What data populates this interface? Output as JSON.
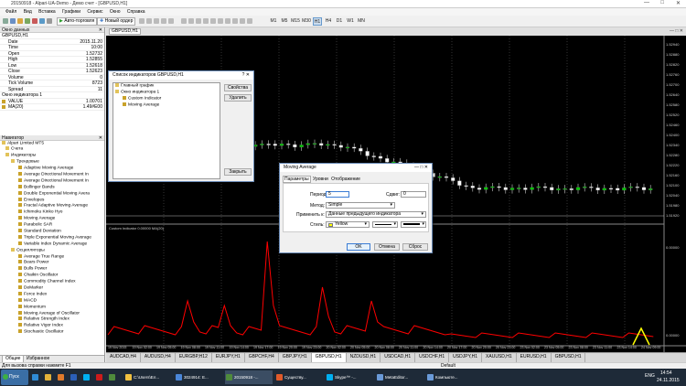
{
  "window": {
    "title": "20150918 - Alpari-UA-Demo - Демо счет - [GBPUSD,H1]"
  },
  "menu": [
    "Файл",
    "Вид",
    "Вставка",
    "Графики",
    "Сервис",
    "Окно",
    "Справка"
  ],
  "toolbar": {
    "autotrade_label": "Авто-торговля",
    "new_order_label": "Новый ордер",
    "timeframes": [
      "M1",
      "M5",
      "M15",
      "M30",
      "H1",
      "H4",
      "D1",
      "W1",
      "MN"
    ],
    "selected_timeframe": "H1"
  },
  "data_window": {
    "title": "Окно данных",
    "symbol": "GBPUSD,H1",
    "rows": [
      {
        "label": "Date",
        "value": "2015.11.20"
      },
      {
        "label": "Time",
        "value": "10:00"
      },
      {
        "label": "Open",
        "value": "1.52732"
      },
      {
        "label": "High",
        "value": "1.52855"
      },
      {
        "label": "Low",
        "value": "1.52618"
      },
      {
        "label": "Close",
        "value": "1.52623"
      },
      {
        "label": "Volume",
        "value": "0"
      },
      {
        "label": "Tick Volume",
        "value": "8723"
      },
      {
        "label": "Spread",
        "value": "11"
      }
    ],
    "indicator_window": "Окно индикатора 1",
    "ind_rows": [
      {
        "label": "VALUE",
        "value": "1.00701"
      },
      {
        "label": "MA(20)",
        "value": "1.49#E00"
      }
    ]
  },
  "navigator": {
    "title": "Навигатор",
    "broker": "Alpari Limited MT5",
    "accounts": "Счета",
    "indicators": "Индикаторы",
    "trend": "Трендовые",
    "trend_items": [
      "Adaptive Moving Average",
      "Average Directional Movement In",
      "Average Directional Movement In",
      "Bollinger Bands",
      "Double Exponential Moving Avera",
      "Envelopes",
      "Fractal Adaptive Moving Average",
      "Ichimoku Kinko Hyo",
      "Moving Average",
      "Parabolic SAR",
      "Standard Deviation",
      "Triple Exponential Moving Average",
      "Variable Index Dynamic Average"
    ],
    "osc": "Осцилляторы",
    "osc_items": [
      "Average True Range",
      "Bears Power",
      "Bulls Power",
      "Chaikin Oscillator",
      "Commodity Channel Index",
      "DeMarker",
      "Force Index",
      "MACD",
      "Momentum",
      "Moving Average of Oscillator",
      "Relative Strength Index",
      "Relative Vigor Index",
      "Stochastic Oscillator"
    ],
    "tabs": [
      "Общие",
      "Избранное"
    ]
  },
  "chart": {
    "tab_label": "GBPUSD,H1",
    "sub_label": "Custom Indicator 0.00000 MA(20)",
    "price_labels": [
      "1.52940",
      "1.52880",
      "1.52820",
      "1.52760",
      "1.52700",
      "1.52640",
      "1.52580",
      "1.52520",
      "1.52460",
      "1.52400",
      "1.52340",
      "1.52280",
      "1.52220",
      "1.52160",
      "1.52100",
      "1.52040",
      "1.51980",
      "1.51920"
    ],
    "sub_price_labels": [
      "0.00000",
      "0.00000"
    ],
    "time_labels": [
      "19 Nov 2015",
      "19 Nov 02:00",
      "19 Nov 05:00",
      "19 Nov 08:00",
      "19 Nov 11:00",
      "19 Nov 14:00",
      "19 Nov 17:00",
      "19 Nov 20:00",
      "19 Nov 23:00",
      "20 Nov 02:00",
      "20 Nov 05:00",
      "20 Nov 08:00",
      "20 Nov 11:00",
      "20 Nov 14:00",
      "20 Nov 17:00",
      "20 Nov 20:00",
      "20 Nov 23:00",
      "23 Nov 02:00",
      "23 Nov 05:00",
      "23 Nov 08:00",
      "23 Nov 11:00",
      "23 Nov 14:00",
      "24 Nov 09:00"
    ],
    "colors": {
      "bull": "#00c800",
      "bear": "#ffffff",
      "osc": "#ff0000",
      "marker": "#ffff00"
    }
  },
  "indicator_list_dialog": {
    "title": "Список индикаторов GBPUSD,H1",
    "items": [
      "Главный график",
      "Окно индикатора 1",
      "Custom Indicator",
      "Moving Average"
    ],
    "buttons": [
      "Свойства",
      "Удалить",
      "Закрыть"
    ]
  },
  "ma_dialog": {
    "title": "Moving Average",
    "tabs": [
      "Параметры",
      "Уровни",
      "Отображение"
    ],
    "period_label": "Период:",
    "period_value": "5",
    "shift_label": "Сдвиг:",
    "shift_value": "0",
    "method_label": "Метод:",
    "method_value": "Simple",
    "apply_label": "Применить к:",
    "apply_value": "Данные предыдущего индикатора",
    "style_label": "Стиль:",
    "color_value": "Yellow",
    "buttons": [
      "OK",
      "Отмена",
      "Сброс"
    ]
  },
  "symbol_tabs": [
    "AUDCAD,H4",
    "AUDUSD,H4",
    "EURGBP,H12",
    "EURJPY,H1",
    "GBPCHF,H4",
    "GBPJPY,H1",
    "GBPUSD,H1",
    "NZDUSD,H1",
    "USDCAD,H1",
    "USDCHF,H1",
    "USDJPY,H1",
    "XAUUSD,H1",
    "EURUSD,H1",
    "GBPUSD,H1"
  ],
  "active_symbol_tab": "GBPUSD,H1",
  "status": {
    "help": "Для вызова справки нажмите F1",
    "profile": "Default"
  },
  "taskbar": {
    "start": "Пуск",
    "items": [
      "C:\\Users\\Ел...",
      "3024914: Е...",
      "20150918 -...",
      "Существу...",
      "Skype™ -...",
      "MetaEditor...",
      "Компьюте..."
    ],
    "lang": "ENG",
    "time": "14:54",
    "date": "24.11.2015"
  }
}
